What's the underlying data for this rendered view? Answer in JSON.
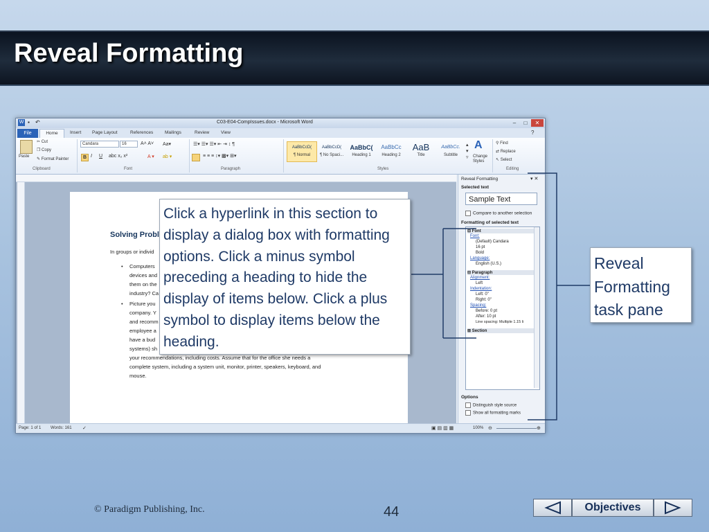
{
  "slide": {
    "title": "Reveal Formatting",
    "footer": "© Paradigm Publishing, Inc.",
    "page_number": "44",
    "nav": {
      "objectives_label": "Objectives"
    }
  },
  "word": {
    "window_title": "C03-E04-CompIssues.docx - Microsoft Word",
    "tabs": [
      "File",
      "Home",
      "Insert",
      "Page Layout",
      "References",
      "Mailings",
      "Review",
      "View"
    ],
    "ribbon": {
      "clipboard": {
        "paste": "Paste",
        "cut": "Cut",
        "copy": "Copy",
        "format_painter": "Format Painter",
        "label": "Clipboard"
      },
      "font": {
        "name": "Candara",
        "size": "16",
        "label": "Font"
      },
      "paragraph": {
        "label": "Paragraph"
      },
      "styles": {
        "label": "Styles",
        "items": [
          {
            "sample": "AaBbCcD(",
            "name": "¶ Normal"
          },
          {
            "sample": "AaBbCcD(",
            "name": "¶ No Spaci..."
          },
          {
            "sample": "AaBbC(",
            "name": "Heading 1"
          },
          {
            "sample": "AaBbCc",
            "name": "Heading 2"
          },
          {
            "sample": "AaB",
            "name": "Title"
          },
          {
            "sample": "AaBbCc.",
            "name": "Subtitle"
          }
        ],
        "change_styles": "Change Styles"
      },
      "editing": {
        "label": "Editing",
        "find": "Find",
        "replace": "Replace",
        "select": "Select"
      }
    },
    "document": {
      "heading": "Solving Probl",
      "intro": "In groups or individ",
      "lines": [
        "Computers",
        "devices and",
        "them on the",
        "industry? Ca",
        "Picture you",
        "company. Y",
        "and recomm",
        "employee a",
        "have a bud",
        "systems) sh",
        "your recommendations, including costs. Assume that for the office she needs a",
        "complete system, including a system unit, monitor, printer, speakers, keyboard, and",
        "mouse."
      ]
    },
    "status": {
      "page": "Page: 1 of 1",
      "words": "Words: 161",
      "zoom": "100%"
    },
    "reveal_pane": {
      "title": "Reveal Formatting",
      "selected_text_label": "Selected text",
      "sample_text": "Sample Text",
      "compare_label": "Compare to another selection",
      "formatting_label": "Formatting of selected text",
      "tree": [
        {
          "kind": "hdr",
          "text": "Font"
        },
        {
          "kind": "link",
          "text": "Font:"
        },
        {
          "kind": "val",
          "text": "(Default) Candara"
        },
        {
          "kind": "val",
          "text": "16 pt"
        },
        {
          "kind": "val",
          "text": "Bold"
        },
        {
          "kind": "link",
          "text": "Language:"
        },
        {
          "kind": "val",
          "text": "English (U.S.)"
        },
        {
          "kind": "hdr",
          "text": "Paragraph"
        },
        {
          "kind": "link",
          "text": "Alignment:"
        },
        {
          "kind": "val",
          "text": "Left"
        },
        {
          "kind": "link",
          "text": "Indentation:"
        },
        {
          "kind": "val",
          "text": "Left:  0\""
        },
        {
          "kind": "val",
          "text": "Right:  0\""
        },
        {
          "kind": "link",
          "text": "Spacing:"
        },
        {
          "kind": "val",
          "text": "Before:  0 pt"
        },
        {
          "kind": "val",
          "text": "After:  10 pt"
        },
        {
          "kind": "val",
          "text": "Line spacing:  Multiple 1.15 li"
        },
        {
          "kind": "hdr",
          "text": "Section"
        }
      ],
      "options_label": "Options",
      "distinguish_label": "Distinguish style source",
      "show_marks_label": "Show all formatting marks"
    }
  },
  "callouts": {
    "main": "Click a hyperlink in this section to display a dialog box with formatting options. Click a minus symbol preceding a heading to hide the display of items below. Click a plus symbol to display items below the heading.",
    "pane": "Reveal Formatting task pane"
  }
}
